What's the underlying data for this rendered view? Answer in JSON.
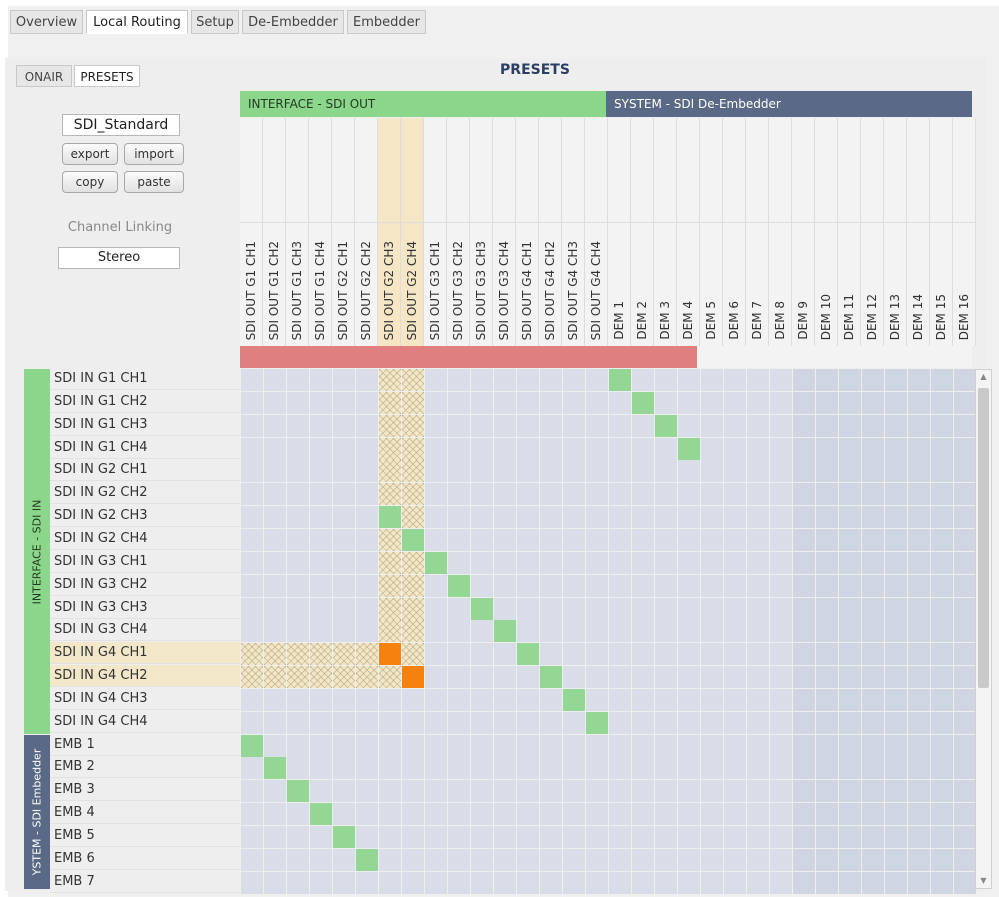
{
  "tabs": [
    "Overview",
    "Local Routing",
    "Setup",
    "De-Embedder",
    "Embedder"
  ],
  "active_tab": "Local Routing",
  "subtabs": [
    "ONAIR",
    "PRESETS"
  ],
  "active_subtab": "PRESETS",
  "page_title": "PRESETS",
  "preset": {
    "name": "SDI_Standard",
    "export_label": "export",
    "import_label": "import",
    "copy_label": "copy",
    "paste_label": "paste",
    "channel_linking_label": "Channel Linking",
    "channel_linking_value": "Stereo"
  },
  "column_groups": [
    {
      "name": "INTERFACE - SDI OUT",
      "color": "#8cd68c"
    },
    {
      "name": "SYSTEM - SDI De-Embedder",
      "color": "#5a6a86"
    }
  ],
  "columns": [
    "SDI OUT G1 CH1",
    "SDI OUT G1 CH2",
    "SDI OUT G1 CH3",
    "SDI OUT G1 CH4",
    "SDI OUT G2 CH1",
    "SDI OUT G2 CH2",
    "SDI OUT G2 CH3",
    "SDI OUT G2 CH4",
    "SDI OUT G3 CH1",
    "SDI OUT G3 CH2",
    "SDI OUT G3 CH3",
    "SDI OUT G3 CH4",
    "SDI OUT G4 CH1",
    "SDI OUT G4 CH2",
    "SDI OUT G4 CH3",
    "SDI OUT G4 CH4",
    "DEM 1",
    "DEM 2",
    "DEM 3",
    "DEM 4",
    "DEM 5",
    "DEM 6",
    "DEM 7",
    "DEM 8",
    "DEM 9",
    "DEM 10",
    "DEM 11",
    "DEM 12",
    "DEM 13",
    "DEM 14",
    "DEM 15",
    "DEM 16"
  ],
  "row_groups": [
    {
      "name": "INTERFACE - SDI IN",
      "color": "#8cd68c"
    },
    {
      "name": "YSTEM - SDI Embedder",
      "color": "#5a6a86"
    }
  ],
  "rows": [
    "SDI IN G1 CH1",
    "SDI IN G1 CH2",
    "SDI IN G1 CH3",
    "SDI IN G1 CH4",
    "SDI IN G2 CH1",
    "SDI IN G2 CH2",
    "SDI IN G2 CH3",
    "SDI IN G2 CH4",
    "SDI IN G3 CH1",
    "SDI IN G3 CH2",
    "SDI IN G3 CH3",
    "SDI IN G3 CH4",
    "SDI IN G4 CH1",
    "SDI IN G4 CH2",
    "SDI IN G4 CH3",
    "SDI IN G4 CH4",
    "EMB 1",
    "EMB 2",
    "EMB 3",
    "EMB 4",
    "EMB 5",
    "EMB 6",
    "EMB 7"
  ],
  "colors": {
    "route_green": "#94d694",
    "route_orange": "#f5820f",
    "header_red": "#e07f7f",
    "highlight_beige": "#f3e7c9"
  }
}
